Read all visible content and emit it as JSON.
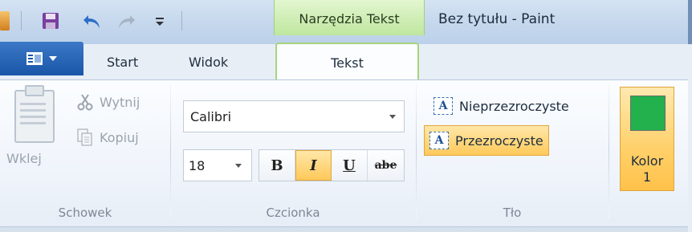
{
  "window": {
    "context_tab": "Narzędzia Tekst",
    "title": "Bez tytułu - Paint"
  },
  "tabs": {
    "start": "Start",
    "view": "Widok",
    "text": "Tekst"
  },
  "clipboard": {
    "paste": "Wklej",
    "cut": "Wytnij",
    "copy": "Kopiuj",
    "group_label": "Schowek"
  },
  "font": {
    "family": "Calibri",
    "size": "18",
    "bold": "B",
    "italic": "I",
    "underline": "U",
    "strike": "abe",
    "group_label": "Czcionka"
  },
  "background": {
    "opaque": "Nieprzezroczyste",
    "transparent": "Przezroczyste",
    "group_label": "Tło"
  },
  "color": {
    "label_line1": "Kolor",
    "label_line2": "1",
    "swatch": "#22b14c"
  }
}
